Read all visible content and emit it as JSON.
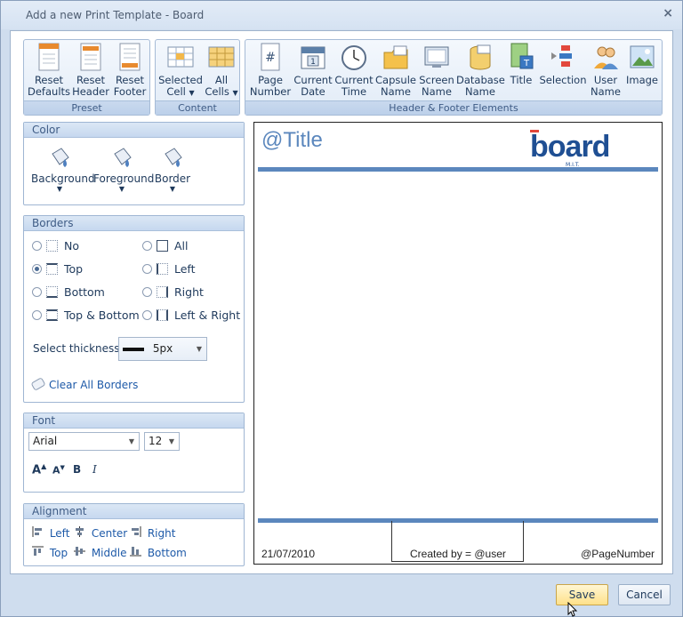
{
  "window": {
    "title": "Add a new Print Template - Board",
    "close_glyph": "×"
  },
  "ribbon": {
    "preset": {
      "caption": "Preset",
      "buttons": [
        {
          "line1": "Reset",
          "line2": "Defaults",
          "icon": "reset-defaults-icon"
        },
        {
          "line1": "Reset",
          "line2": "Header",
          "icon": "reset-header-icon"
        },
        {
          "line1": "Reset",
          "line2": "Footer",
          "icon": "reset-footer-icon"
        }
      ]
    },
    "content": {
      "caption": "Content",
      "buttons": [
        {
          "line1": "Selected",
          "line2": "Cell",
          "icon": "selected-cell-icon",
          "dropdown": "▼"
        },
        {
          "line1": "All",
          "line2": "Cells",
          "icon": "all-cells-icon",
          "dropdown": "▼"
        }
      ]
    },
    "elements": {
      "caption": "Header & Footer Elements",
      "buttons": [
        {
          "line1": "Page",
          "line2": "Number",
          "icon": "page-number-icon"
        },
        {
          "line1": "Current",
          "line2": "Date",
          "icon": "calendar-icon"
        },
        {
          "line1": "Current",
          "line2": "Time",
          "icon": "clock-icon"
        },
        {
          "line1": "Capsule",
          "line2": "Name",
          "icon": "capsule-folder-icon"
        },
        {
          "line1": "Screen",
          "line2": "Name",
          "icon": "screen-icon"
        },
        {
          "line1": "Database",
          "line2": "Name",
          "icon": "database-icon"
        },
        {
          "line1": "Title",
          "line2": "",
          "icon": "title-icon"
        },
        {
          "line1": "Selection",
          "line2": "",
          "icon": "selection-icon"
        },
        {
          "line1": "User",
          "line2": "Name",
          "icon": "user-icon"
        },
        {
          "line1": "Image",
          "line2": "",
          "icon": "image-icon"
        }
      ]
    }
  },
  "color_panel": {
    "title": "Color",
    "buttons": [
      {
        "label": "Background",
        "dropdown": "▼"
      },
      {
        "label": "Foreground",
        "dropdown": "▼"
      },
      {
        "label": "Border",
        "dropdown": "▼"
      }
    ]
  },
  "borders_panel": {
    "title": "Borders",
    "options": [
      {
        "label": "No",
        "checked": false
      },
      {
        "label": "All",
        "checked": false
      },
      {
        "label": "Top",
        "checked": true
      },
      {
        "label": "Left",
        "checked": false
      },
      {
        "label": "Bottom",
        "checked": false
      },
      {
        "label": "Right",
        "checked": false
      },
      {
        "label": "Top & Bottom",
        "checked": false
      },
      {
        "label": "Left & Right",
        "checked": false
      }
    ],
    "thickness_label": "Select thickness:",
    "thickness_value": "5px",
    "clear_label": "Clear All Borders"
  },
  "font_panel": {
    "title": "Font",
    "family": "Arial",
    "size": "12",
    "grow_glyph": "A",
    "shrink_glyph": "A",
    "bold_glyph": "B",
    "italic_glyph": "I"
  },
  "alignment_panel": {
    "title": "Alignment",
    "left": "Left",
    "center": "Center",
    "right": "Right",
    "top": "Top",
    "middle": "Middle",
    "bottom": "Bottom"
  },
  "preview": {
    "title_placeholder": "@Title",
    "logo_text": "board",
    "logo_sub": "M.I.T.",
    "footer_date": "21/07/2010",
    "footer_created": "Created by = @user",
    "footer_page": "@PageNumber",
    "accent": "#5b87bd"
  },
  "buttons": {
    "save": "Save",
    "cancel": "Cancel"
  }
}
